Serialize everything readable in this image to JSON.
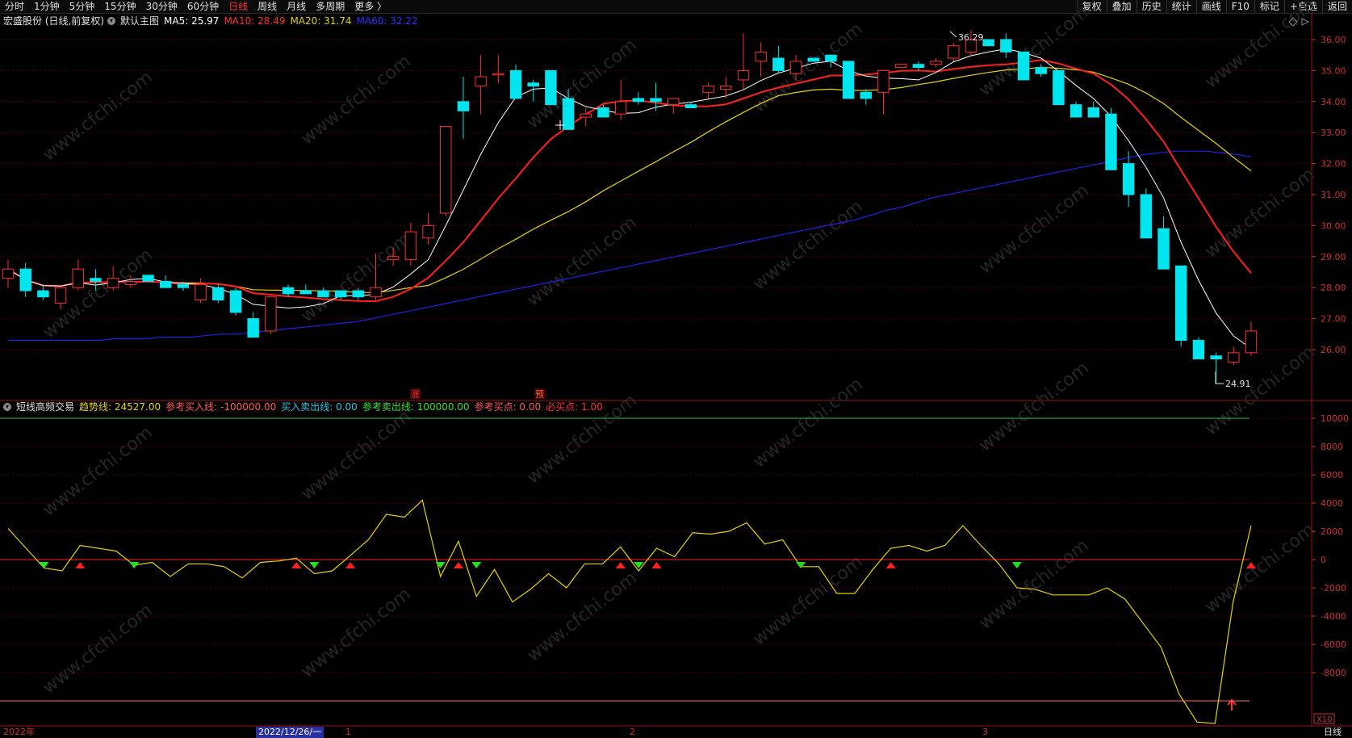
{
  "toolbar": {
    "periods": [
      "分时",
      "1分钟",
      "5分钟",
      "15分钟",
      "30分钟",
      "60分钟",
      "日线",
      "周线",
      "月线",
      "多周期",
      "更多 〉"
    ],
    "active_period": "日线",
    "right_buttons": [
      "复权",
      "叠加",
      "历史",
      "统计",
      "画线",
      "F10",
      "标记",
      "+自选",
      "返回"
    ]
  },
  "main_chart": {
    "stock": "宏盛股份 (日线,前复权)",
    "template": "默认主图",
    "ma5_label": "MA5: 25.97",
    "ma10_label": "MA10: 28.49",
    "ma20_label": "MA20: 31.74",
    "ma60_label": "MA60: 32.22",
    "high_label": "36.29",
    "low_label": "24.91",
    "marker_zhang": "涨",
    "marker_yu": "预",
    "y_ticks": [
      "36.00",
      "35.00",
      "34.00",
      "33.00",
      "32.00",
      "31.00",
      "30.00",
      "29.00",
      "28.00",
      "27.00",
      "26.00"
    ]
  },
  "indicator": {
    "name": "短线高频交易",
    "trend_label": "趋势线: 24527.00",
    "ref_buy_line": "参考买入线: -100000.00",
    "buy_sell_line": "买入卖出线: 0.00",
    "ref_sell_line": "参考卖出线: 100000.00",
    "ref_buy_point": "参考买点: 0.00",
    "must_buy_point": "必买点: 1.00",
    "y_ticks": [
      "10000",
      "8000",
      "6000",
      "4000",
      "2000",
      "0",
      "-2000",
      "-4000",
      "-6000",
      "-8000"
    ],
    "scale_badge": "X10"
  },
  "bottom": {
    "year": "2022年",
    "selected_date": "2022/12/26/一",
    "month1": "1",
    "month2": "2",
    "month3": "3",
    "period_label": "日线"
  },
  "colors": {
    "up": "#ff3030",
    "down": "#00e5ee",
    "ma5": "#ffffff",
    "ma10": "#ff2020",
    "ma20": "#e6d400",
    "ma60": "#2020e8",
    "trend": "#e6d400"
  },
  "chart_data": {
    "type": "candlestick",
    "ohlc": [
      [
        28.3,
        28.9,
        28.0,
        28.6
      ],
      [
        28.6,
        28.8,
        27.7,
        27.9
      ],
      [
        27.9,
        28.1,
        27.6,
        27.7
      ],
      [
        27.5,
        28.0,
        27.3,
        28.0
      ],
      [
        28.0,
        28.9,
        27.9,
        28.6
      ],
      [
        28.3,
        28.6,
        27.9,
        28.2
      ],
      [
        28.0,
        28.7,
        27.9,
        28.3
      ],
      [
        28.1,
        28.4,
        28.0,
        28.2
      ],
      [
        28.4,
        28.4,
        28.2,
        28.2
      ],
      [
        28.2,
        28.4,
        28.0,
        28.0
      ],
      [
        28.1,
        28.2,
        27.9,
        28.0
      ],
      [
        27.6,
        28.3,
        27.5,
        28.1
      ],
      [
        28.0,
        28.1,
        27.5,
        27.6
      ],
      [
        27.9,
        28.0,
        27.1,
        27.2
      ],
      [
        27.0,
        27.2,
        26.6,
        26.4
      ],
      [
        26.6,
        27.5,
        26.5,
        27.7
      ],
      [
        28.0,
        28.1,
        27.7,
        27.8
      ],
      [
        27.9,
        28.1,
        27.8,
        27.8
      ],
      [
        27.9,
        28.0,
        27.7,
        27.7
      ],
      [
        27.9,
        27.9,
        27.6,
        27.7
      ],
      [
        27.9,
        28.0,
        27.6,
        27.7
      ],
      [
        27.7,
        29.1,
        27.6,
        28.0
      ],
      [
        28.9,
        29.3,
        28.7,
        29.0
      ],
      [
        28.9,
        30.1,
        28.7,
        29.8
      ],
      [
        29.6,
        30.4,
        29.4,
        30.0
      ],
      [
        30.4,
        33.1,
        30.3,
        33.2
      ],
      [
        34.0,
        34.8,
        32.8,
        33.7
      ],
      [
        34.5,
        35.5,
        33.6,
        34.8
      ],
      [
        34.9,
        35.5,
        34.6,
        34.9
      ],
      [
        35.0,
        35.2,
        34.1,
        34.1
      ],
      [
        34.6,
        34.7,
        34.0,
        34.5
      ],
      [
        35.0,
        35.0,
        33.9,
        33.9
      ],
      [
        34.1,
        34.4,
        33.1,
        33.1
      ],
      [
        33.5,
        33.8,
        33.2,
        33.6
      ],
      [
        33.8,
        33.9,
        33.5,
        33.5
      ],
      [
        33.6,
        34.7,
        33.4,
        34.0
      ],
      [
        34.1,
        34.3,
        33.9,
        34.0
      ],
      [
        34.1,
        34.6,
        33.7,
        34.0
      ],
      [
        33.9,
        34.1,
        33.6,
        34.1
      ],
      [
        33.9,
        34.0,
        33.8,
        33.8
      ],
      [
        34.3,
        34.6,
        34.1,
        34.5
      ],
      [
        34.4,
        34.8,
        34.1,
        34.5
      ],
      [
        34.7,
        36.2,
        34.4,
        35.0
      ],
      [
        35.3,
        35.9,
        34.8,
        35.6
      ],
      [
        35.4,
        35.8,
        34.9,
        35.0
      ],
      [
        34.9,
        35.5,
        34.7,
        35.3
      ],
      [
        35.4,
        35.4,
        35.3,
        35.3
      ],
      [
        35.5,
        35.5,
        35.1,
        35.3
      ],
      [
        35.3,
        35.2,
        34.1,
        34.1
      ],
      [
        34.3,
        34.4,
        33.9,
        34.1
      ],
      [
        34.3,
        35.0,
        33.6,
        35.0
      ],
      [
        35.1,
        35.2,
        35.1,
        35.2
      ],
      [
        35.2,
        35.3,
        35.0,
        35.1
      ],
      [
        35.2,
        35.4,
        35.1,
        35.3
      ],
      [
        35.4,
        35.9,
        35.3,
        35.8
      ],
      [
        35.6,
        36.3,
        35.5,
        36.0
      ],
      [
        36.0,
        36.0,
        35.8,
        35.8
      ],
      [
        36.0,
        36.2,
        35.4,
        35.6
      ],
      [
        35.6,
        35.6,
        34.7,
        34.7
      ],
      [
        35.1,
        35.2,
        34.8,
        34.9
      ],
      [
        35.0,
        35.0,
        33.9,
        33.9
      ],
      [
        33.9,
        34.0,
        33.5,
        33.5
      ],
      [
        33.8,
        34.0,
        33.5,
        33.5
      ],
      [
        33.6,
        33.8,
        31.8,
        31.8
      ],
      [
        32.0,
        32.4,
        30.6,
        31.0
      ],
      [
        31.0,
        31.2,
        29.6,
        29.6
      ],
      [
        29.9,
        30.3,
        28.6,
        28.6
      ],
      [
        28.7,
        28.7,
        26.1,
        26.3
      ],
      [
        26.3,
        26.4,
        25.8,
        25.7
      ],
      [
        25.8,
        25.9,
        24.9,
        25.7
      ],
      [
        25.6,
        26.1,
        25.5,
        25.9
      ],
      [
        25.9,
        26.9,
        25.8,
        26.6
      ]
    ],
    "ma60": [
      26.3,
      26.3,
      26.3,
      26.3,
      26.3,
      26.3,
      26.3,
      26.35,
      26.35,
      26.35,
      26.4,
      26.4,
      26.4,
      26.45,
      26.5,
      26.5,
      26.55,
      26.6,
      26.65,
      26.7,
      26.75,
      26.8,
      26.85,
      26.9,
      27.0,
      27.1,
      27.2,
      27.3,
      27.4,
      27.5,
      27.6,
      27.7,
      27.8,
      27.9,
      28.0,
      28.1,
      28.2,
      28.3,
      28.4,
      28.5,
      28.6,
      28.7,
      28.8,
      28.9,
      29.0,
      29.1,
      29.2,
      29.3,
      29.4,
      29.5,
      29.6,
      29.7,
      29.8,
      29.9,
      30.0,
      30.1,
      30.2,
      30.35,
      30.5,
      30.6,
      30.75,
      30.9,
      31.0,
      31.1,
      31.2,
      31.3,
      31.4,
      31.5,
      31.6,
      31.7,
      31.8,
      31.9,
      32.0,
      32.1,
      32.2,
      32.3,
      32.35,
      32.4,
      32.4,
      32.4,
      32.35,
      32.3,
      32.22
    ]
  },
  "indicator_data": {
    "trend": [
      2200,
      800,
      -600,
      -800,
      1000,
      800,
      600,
      -400,
      -200,
      -1200,
      -300,
      -300,
      -500,
      -1300,
      -200,
      -100,
      100,
      -1000,
      -800,
      300,
      1400,
      3200,
      3000,
      4200,
      -1200,
      1300,
      -2600,
      -700,
      -3000,
      -2100,
      -1000,
      -2000,
      -300,
      -300,
      900,
      -800,
      800,
      200,
      1900,
      1800,
      2000,
      2600,
      1100,
      1400,
      -500,
      -500,
      -2400,
      -2400,
      -700,
      800,
      1000,
      600,
      1000,
      2400,
      1000,
      -300,
      -2000,
      -2100,
      -2500,
      -2500,
      -2500,
      -2000,
      -2800,
      -4500,
      -6200,
      -9500,
      -11500,
      -11600,
      -3000,
      2400
    ],
    "sell_markers": [
      2,
      7,
      17,
      24,
      26,
      35,
      44,
      56
    ],
    "buy_markers": [
      4,
      16,
      19,
      25,
      34,
      36,
      49,
      69
    ]
  }
}
